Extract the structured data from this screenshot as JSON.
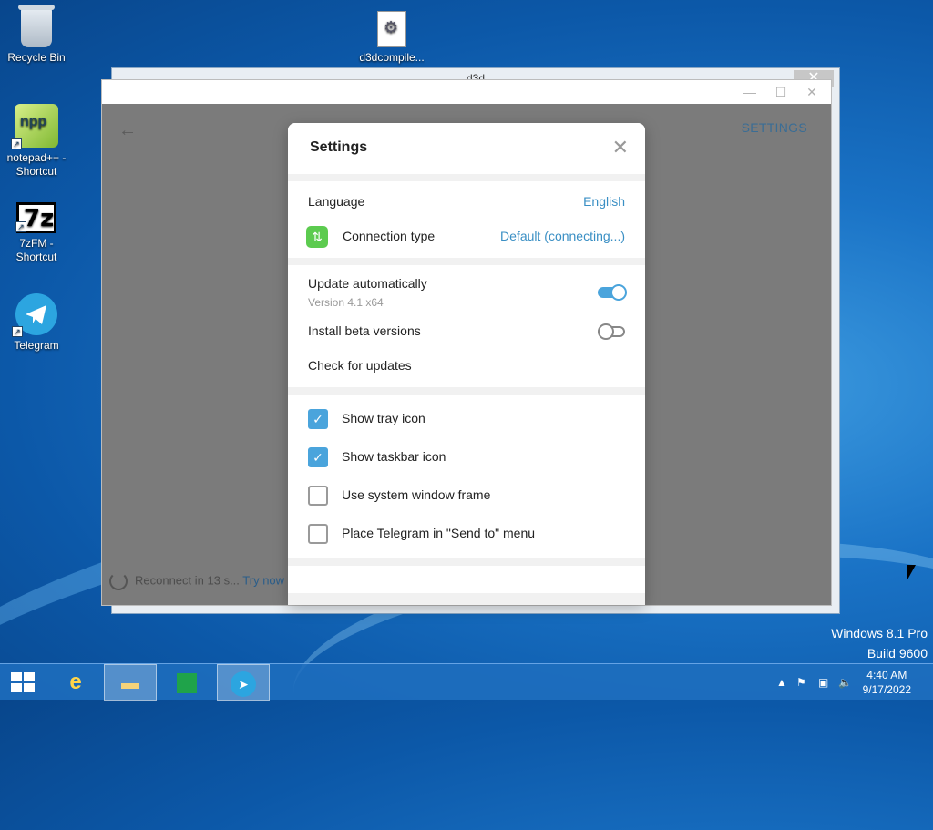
{
  "desktop": {
    "icons": [
      {
        "label": "Recycle Bin"
      },
      {
        "label": "d3dcompile..."
      },
      {
        "label": "notepad++ -\nShortcut"
      },
      {
        "label": "7zFM -\nShortcut"
      },
      {
        "label": "Telegram"
      }
    ],
    "watermark": {
      "line1": "Windows 8.1 Pro",
      "line2": "Build 9600"
    }
  },
  "background_window": {
    "title": "d3d"
  },
  "telegram": {
    "header_label": "SETTINGS",
    "reconnect_text": "Reconnect in 13 s...",
    "try_now": "Try now"
  },
  "settings": {
    "title": "Settings",
    "language_label": "Language",
    "language_value": "English",
    "connection_label": "Connection type",
    "connection_value": "Default (connecting...)",
    "update_label": "Update automatically",
    "version": "Version 4.1 x64",
    "update_on": true,
    "beta_label": "Install beta versions",
    "beta_on": false,
    "check_updates": "Check for updates",
    "options": [
      {
        "label": "Show tray icon",
        "checked": true
      },
      {
        "label": "Show taskbar icon",
        "checked": true
      },
      {
        "label": "Use system window frame",
        "checked": false
      },
      {
        "label": "Place Telegram in \"Send to\" menu",
        "checked": false
      }
    ]
  },
  "taskbar": {
    "clock_time": "4:40 AM",
    "clock_date": "9/17/2022"
  }
}
